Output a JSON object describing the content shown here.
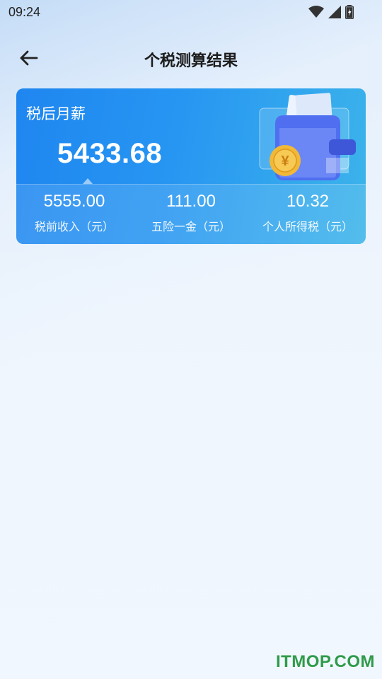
{
  "status_bar": {
    "time": "09:24"
  },
  "header": {
    "title": "个税测算结果"
  },
  "card": {
    "label": "税后月薪",
    "amount": "5433.68",
    "stats": [
      {
        "value": "5555.00",
        "caption": "税前收入（元）"
      },
      {
        "value": "111.00",
        "caption": "五险一金（元）"
      },
      {
        "value": "10.32",
        "caption": "个人所得税（元）"
      }
    ]
  },
  "watermark": "ITMOP.COM",
  "colors": {
    "card_start": "#1f86f0",
    "card_end": "#3cb4ea",
    "background": "#eef5fd",
    "watermark": "#2f9b4a"
  }
}
